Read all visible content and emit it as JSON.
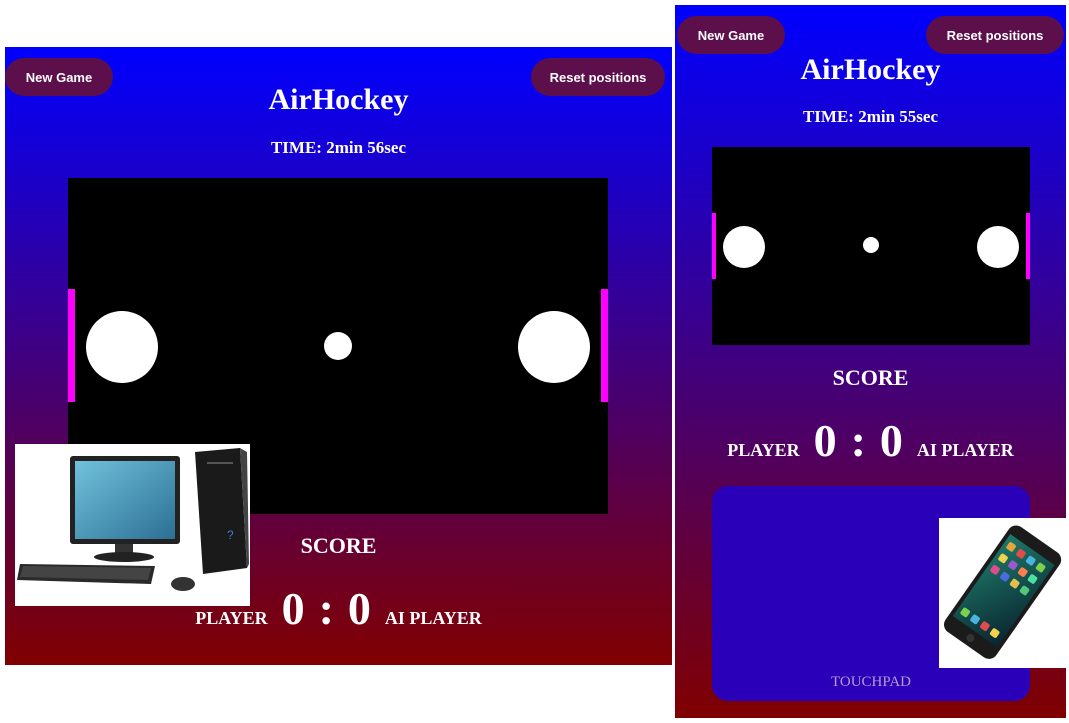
{
  "desktop": {
    "new_game_label": "New Game",
    "reset_label": "Reset positions",
    "title": "AirHockey",
    "time": "TIME: 2min 56sec",
    "score_title": "SCORE",
    "player_label": "PLAYER",
    "ai_label": "AI PLAYER",
    "player_score": "0",
    "separator": ":",
    "ai_score": "0"
  },
  "mobile": {
    "new_game_label": "New Game",
    "reset_label": "Reset positions",
    "title": "AirHockey",
    "time": "TIME: 2min 55sec",
    "score_title": "SCORE",
    "player_label": "PLAYER",
    "ai_label": "AI PLAYER",
    "player_score": "0",
    "separator": ":",
    "ai_score": "0",
    "touchpad_label": "TOUCHPAD"
  },
  "colors": {
    "gradient_top": "#0000ff",
    "gradient_bottom": "#800000",
    "button_bg": "#5c0f4a",
    "paddle_goal": "#ff00ff",
    "rink": "#000000"
  },
  "icons": [
    "desktop-computer-image",
    "smartphone-image"
  ]
}
